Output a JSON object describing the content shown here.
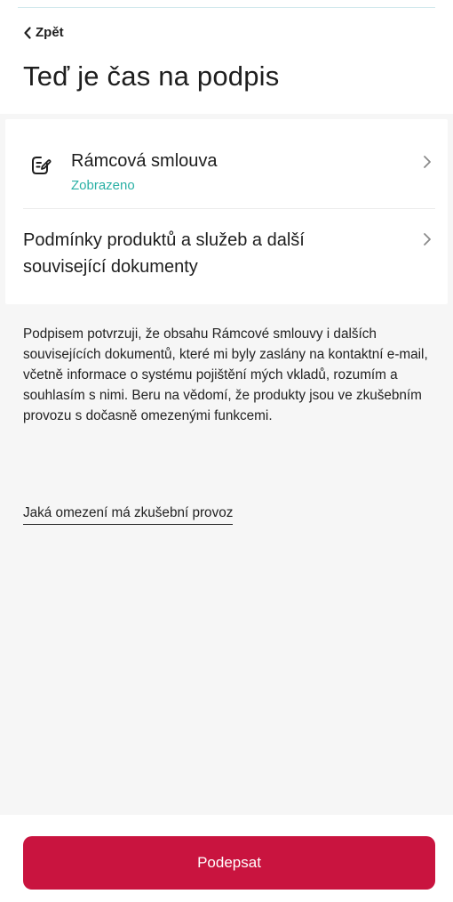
{
  "nav": {
    "back_label": "Zpět"
  },
  "page": {
    "title": "Teď je čas na podpis"
  },
  "documents": {
    "framework_contract": {
      "label": "Rámcová smlouva",
      "status": "Zobrazeno",
      "icon": "document-edit-icon"
    },
    "terms": {
      "label": "Podmínky produktů a služeb a další související dokumenty"
    }
  },
  "consent": {
    "text": "Podpisem potvrzuji, že obsahu Rámcové smlouvy i dalších souvisejících dokumentů, které mi byly zaslány na kontaktní e-mail, včetně informace o systému pojištění mých vkladů, rozumím a souhlasím s nimi. Beru na vědomí, že produkty jsou ve zkušebním provozu s dočasně omezenými funkcemi.",
    "link_label": "Jaká omezení má zkušební provoz"
  },
  "actions": {
    "sign_label": "Podepsat"
  },
  "colors": {
    "primary": "#c9143f",
    "status_viewed": "#2ab0a5",
    "text": "#1e1e1e",
    "background": "#f6f6f6"
  }
}
